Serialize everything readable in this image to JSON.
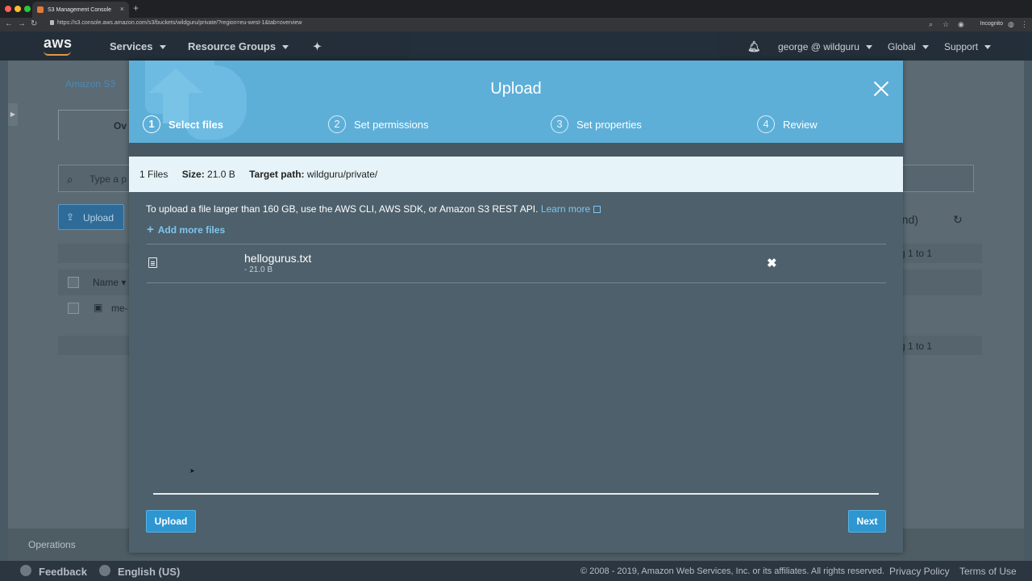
{
  "browser": {
    "tab_title": "S3 Management Console",
    "tab_close": "×",
    "new_tab": "+",
    "url": "https://s3.console.aws.amazon.com/s3/buckets/wildguru/private/?region=eu-west-1&tab=overview",
    "incognito_label": "Incognito",
    "traffic_colors": [
      "#ff5f57",
      "#febc2e",
      "#28c840"
    ]
  },
  "aws_nav": {
    "logo_text": "aws",
    "services": "Services",
    "resource_groups": "Resource Groups",
    "user": "george @ wildguru",
    "region": "Global",
    "support": "Support"
  },
  "background": {
    "breadcrumb": "Amazon S3",
    "tab_fragment": "Ov",
    "search_placeholder_fragment": "Type a p",
    "upload_button": "Upload",
    "region_fragment": "eland)",
    "name_header": "Name",
    "row_fragment": "me-",
    "pagination_fragment_top": "g 1 to 1",
    "pagination_fragment_bottom": "g 1 to 1",
    "operations": "Operations"
  },
  "footer": {
    "feedback": "Feedback",
    "language": "English (US)",
    "copyright": "© 2008 - 2019, Amazon Web Services, Inc. or its affiliates. All rights reserved.",
    "privacy": "Privacy Policy",
    "terms": "Terms of Use"
  },
  "modal": {
    "title": "Upload",
    "steps": [
      {
        "num": "1",
        "label": "Select files"
      },
      {
        "num": "2",
        "label": "Set permissions"
      },
      {
        "num": "3",
        "label": "Set properties"
      },
      {
        "num": "4",
        "label": "Review"
      }
    ],
    "info": {
      "files": "1 Files",
      "size_label": "Size:",
      "size_value": "21.0 B",
      "target_label": "Target path:",
      "target_value": "wildguru/private/"
    },
    "note": "To upload a file larger than 160 GB, use the AWS CLI, AWS SDK, or Amazon S3 REST API.",
    "learn_more": "Learn more",
    "add_more_files": "Add more files",
    "file": {
      "name": "hellogurus.txt",
      "size": "- 21.0 B"
    },
    "upload_button": "Upload",
    "next_button": "Next"
  }
}
